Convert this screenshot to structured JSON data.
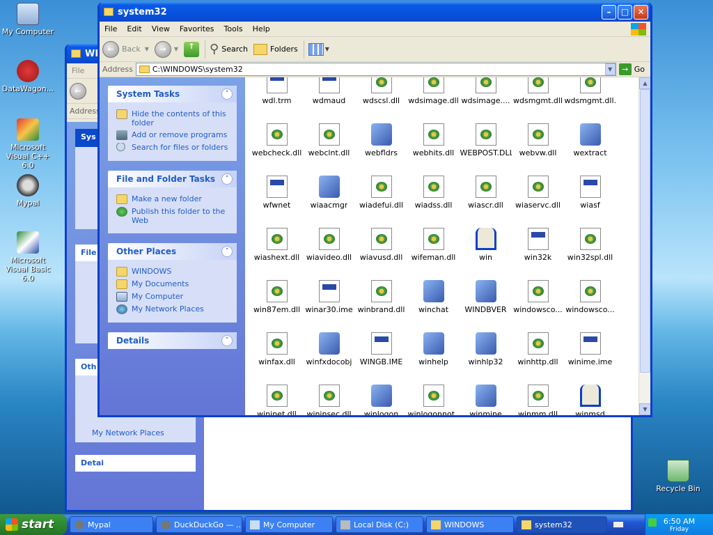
{
  "desktop": {
    "icons": [
      {
        "label": "My Computer"
      },
      {
        "label": "DataWagon..."
      },
      {
        "label": "Microsoft Visual C++ 6.0"
      },
      {
        "label": "Mypal"
      },
      {
        "label": "Microsoft Visual Basic 6.0"
      },
      {
        "label": "Recycle Bin"
      }
    ]
  },
  "back_window": {
    "title": "WIN",
    "menu_file": "File",
    "address_label": "Address",
    "panels": [
      "Sys",
      "File",
      "Oth"
    ],
    "other_link": "My Network Places",
    "details": "Detai"
  },
  "window": {
    "title": "system32",
    "menu": [
      "File",
      "Edit",
      "View",
      "Favorites",
      "Tools",
      "Help"
    ],
    "toolbar": {
      "back": "Back",
      "search": "Search",
      "folders": "Folders"
    },
    "address": {
      "label": "Address",
      "value": "C:\\WINDOWS\\system32",
      "go": "Go"
    },
    "panels": [
      {
        "title": "System Tasks",
        "items": [
          "Hide the contents of this folder",
          "Add or remove programs",
          "Search for files or folders"
        ]
      },
      {
        "title": "File and Folder Tasks",
        "items": [
          "Make a new folder",
          "Publish this folder to the Web"
        ]
      },
      {
        "title": "Other Places",
        "items": [
          "WINDOWS",
          "My Documents",
          "My Computer",
          "My Network Places"
        ]
      },
      {
        "title": "Details",
        "items": []
      }
    ],
    "files": [
      {
        "name": "wdl.trm",
        "type": "doc"
      },
      {
        "name": "wdmaud",
        "type": "doc"
      },
      {
        "name": "wdscsl.dll",
        "type": "dll"
      },
      {
        "name": "wdsimage.dll",
        "type": "dll"
      },
      {
        "name": "wdsimage....",
        "type": "dll"
      },
      {
        "name": "wdsmgmt.dll",
        "type": "dll"
      },
      {
        "name": "wdsmgmt.dll...",
        "type": "dll"
      },
      {
        "name": "webcheck.dll",
        "type": "dll"
      },
      {
        "name": "webclnt.dll",
        "type": "dll"
      },
      {
        "name": "webfldrs",
        "type": "app"
      },
      {
        "name": "webhits.dll",
        "type": "dll"
      },
      {
        "name": "WEBPOST.DLL",
        "type": "dll"
      },
      {
        "name": "webvw.dll",
        "type": "dll"
      },
      {
        "name": "wextract",
        "type": "app"
      },
      {
        "name": "wfwnet",
        "type": "doc"
      },
      {
        "name": "wiaacmgr",
        "type": "app"
      },
      {
        "name": "wiadefui.dll",
        "type": "dll"
      },
      {
        "name": "wiadss.dll",
        "type": "dll"
      },
      {
        "name": "wiascr.dll",
        "type": "dll"
      },
      {
        "name": "wiaservc.dll",
        "type": "dll"
      },
      {
        "name": "wiasf",
        "type": "doc"
      },
      {
        "name": "wiashext.dll",
        "type": "dll"
      },
      {
        "name": "wiavideo.dll",
        "type": "dll"
      },
      {
        "name": "wiavusd.dll",
        "type": "dll"
      },
      {
        "name": "wifeman.dll",
        "type": "dll"
      },
      {
        "name": "win",
        "type": "win"
      },
      {
        "name": "win32k",
        "type": "doc"
      },
      {
        "name": "win32spl.dll",
        "type": "dll"
      },
      {
        "name": "win87em.dll",
        "type": "dll"
      },
      {
        "name": "winar30.ime",
        "type": "doc"
      },
      {
        "name": "winbrand.dll",
        "type": "dll"
      },
      {
        "name": "winchat",
        "type": "app"
      },
      {
        "name": "WINDBVER",
        "type": "app"
      },
      {
        "name": "windowsco...",
        "type": "dll"
      },
      {
        "name": "windowsco...",
        "type": "dll"
      },
      {
        "name": "winfax.dll",
        "type": "dll"
      },
      {
        "name": "winfxdocobj",
        "type": "app"
      },
      {
        "name": "WINGB.IME",
        "type": "doc"
      },
      {
        "name": "winhelp",
        "type": "app"
      },
      {
        "name": "winhlp32",
        "type": "app"
      },
      {
        "name": "winhttp.dll",
        "type": "dll"
      },
      {
        "name": "winime.ime",
        "type": "doc"
      },
      {
        "name": "wininet.dll",
        "type": "dll"
      },
      {
        "name": "wininsec.dll",
        "type": "dll"
      },
      {
        "name": "winlogon",
        "type": "app"
      },
      {
        "name": "winlogonnot...",
        "type": "dll"
      },
      {
        "name": "winmine",
        "type": "app"
      },
      {
        "name": "winmm.dll",
        "type": "dll"
      },
      {
        "name": "winmsd",
        "type": "win"
      }
    ]
  },
  "taskbar": {
    "start": "start",
    "tasks": [
      "Mypal",
      "DuckDuckGo — ...",
      "My Computer",
      "Local Disk (C:)",
      "WINDOWS",
      "system32"
    ],
    "time": "6:50 AM",
    "day": "Friday"
  },
  "colors": {
    "accent": "#0a5ae6",
    "panel_link": "#215dc6",
    "taskbar": "#2157d7"
  }
}
